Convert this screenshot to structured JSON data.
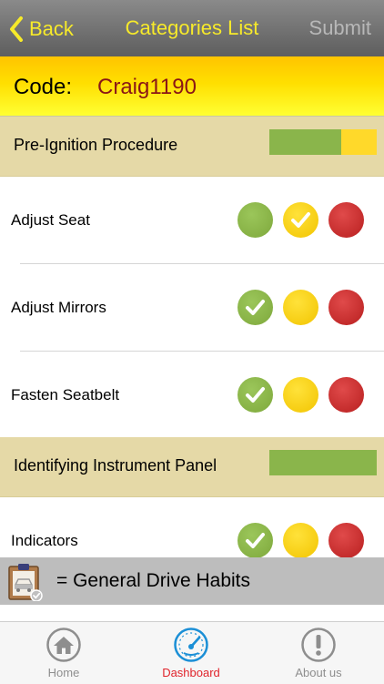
{
  "navbar": {
    "back_label": "Back",
    "title": "Categories List",
    "submit_label": "Submit"
  },
  "code": {
    "label": "Code:",
    "value": "Craig1190"
  },
  "sections": [
    {
      "title": "Pre-Ignition Procedure",
      "progress": {
        "green_percent": 67,
        "yellow_percent": 33
      },
      "items": [
        {
          "label": "Adjust Seat",
          "selected": "yellow"
        },
        {
          "label": "Adjust Mirrors",
          "selected": "green"
        },
        {
          "label": "Fasten Seatbelt",
          "selected": "green"
        }
      ]
    },
    {
      "title": "Identifying Instrument Panel",
      "progress": {
        "green_percent": 100,
        "yellow_percent": 0
      },
      "items": [
        {
          "label": "Indicators",
          "selected": "green"
        }
      ]
    }
  ],
  "legend": {
    "text": "= General Drive Habits",
    "icon": "clipboard-car-icon"
  },
  "tabs": [
    {
      "label": "Home",
      "icon": "home-icon",
      "active": false
    },
    {
      "label": "Dashboard",
      "icon": "speedometer-icon",
      "active": true
    },
    {
      "label": "About us",
      "icon": "info-exclamation-icon",
      "active": false
    }
  ],
  "colors": {
    "accent": "#f7ea2a",
    "green": "#8ab54b",
    "yellow": "#ffd92a",
    "red": "#c62828",
    "active_tab": "#e0242c"
  }
}
